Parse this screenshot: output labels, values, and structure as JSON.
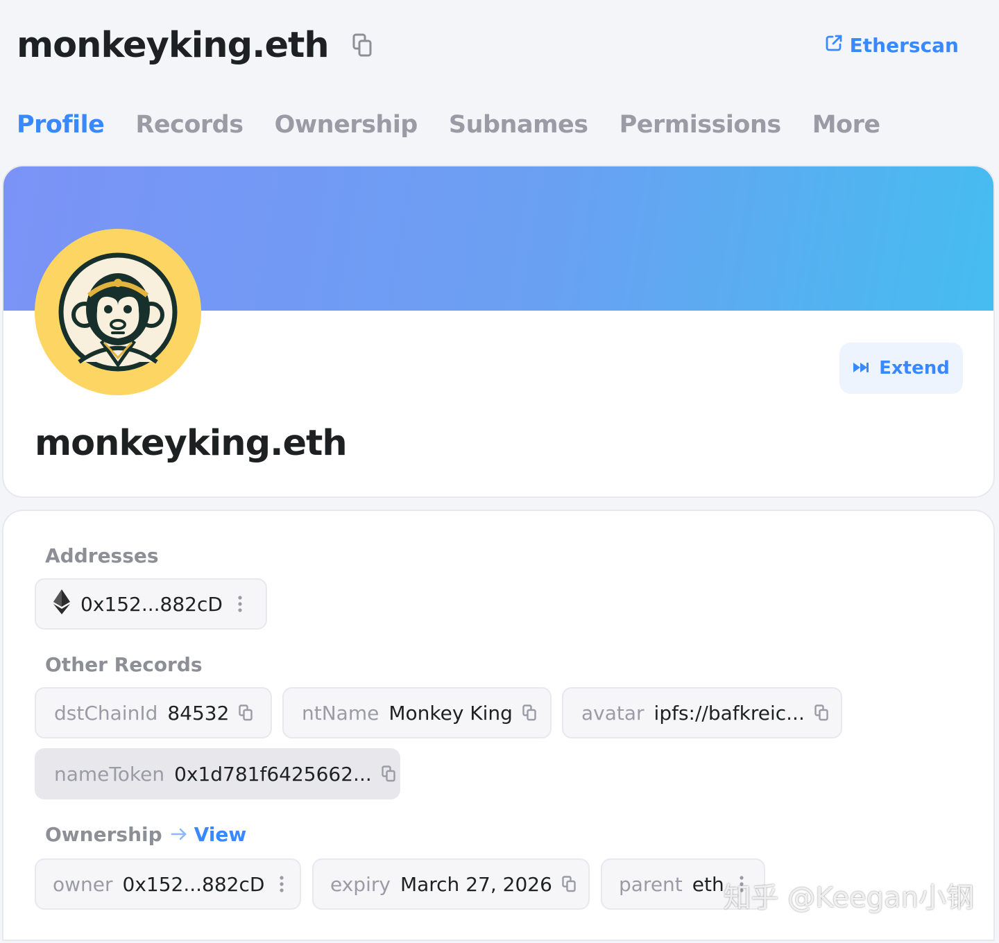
{
  "header": {
    "title": "monkeyking.eth",
    "etherscan_label": "Etherscan"
  },
  "tabs": [
    {
      "label": "Profile",
      "active": true
    },
    {
      "label": "Records"
    },
    {
      "label": "Ownership"
    },
    {
      "label": "Subnames"
    },
    {
      "label": "Permissions"
    },
    {
      "label": "More"
    }
  ],
  "profile": {
    "name": "monkeyking.eth",
    "extend_label": "Extend"
  },
  "addresses": {
    "label": "Addresses",
    "eth": "0x152...882cD"
  },
  "other_records": {
    "label": "Other Records",
    "items": [
      {
        "key": "dstChainId",
        "value": "84532"
      },
      {
        "key": "ntName",
        "value": "Monkey King"
      },
      {
        "key": "avatar",
        "value": "ipfs://bafkreic..."
      },
      {
        "key": "nameToken",
        "value": "0x1d781f6425662..."
      }
    ]
  },
  "ownership": {
    "label": "Ownership",
    "view_label": "View",
    "items": [
      {
        "key": "owner",
        "value": "0x152...882cD"
      },
      {
        "key": "expiry",
        "value": "March 27, 2026"
      },
      {
        "key": "parent",
        "value": "eth"
      }
    ]
  },
  "watermark": "知乎 @Keegan小钢",
  "colors": {
    "accent": "#3889ff",
    "avatar_bg": "#fdd563"
  }
}
